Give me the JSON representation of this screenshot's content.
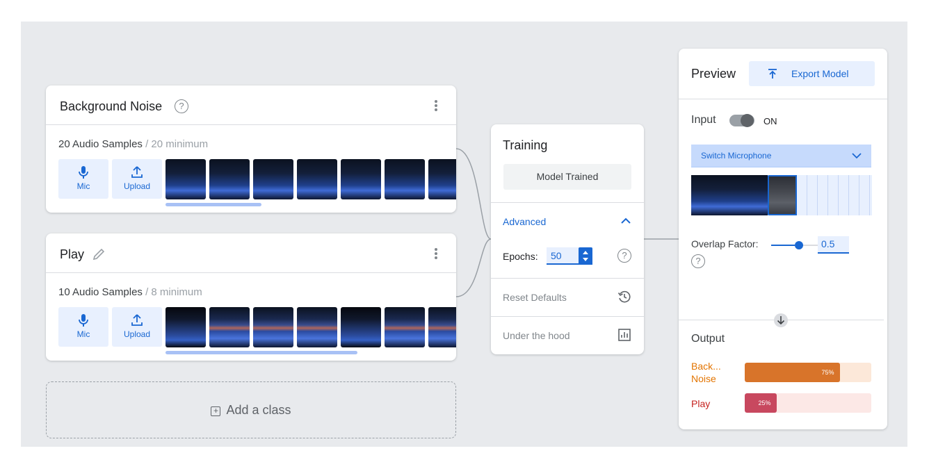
{
  "classes": [
    {
      "name": "Background Noise",
      "samples": "20 Audio Samples",
      "minimum": " / 20 minimum",
      "mic_label": "Mic",
      "upload_label": "Upload",
      "scroll_fraction": 0.33
    },
    {
      "name": "Play",
      "samples": "10 Audio Samples",
      "minimum": " / 8 minimum",
      "mic_label": "Mic",
      "upload_label": "Upload",
      "scroll_fraction": 0.66
    }
  ],
  "add_class": {
    "label": "Add a class",
    "icon": "plus-square-icon"
  },
  "training": {
    "title": "Training",
    "status_button": "Model Trained",
    "advanced_label": "Advanced",
    "epochs_label": "Epochs:",
    "epochs_value": "50",
    "reset_label": "Reset Defaults",
    "hood_label": "Under the hood"
  },
  "preview": {
    "title": "Preview",
    "export_label": "Export Model",
    "input_label": "Input",
    "toggle_text": "ON",
    "toggle_on": true,
    "mic_select": "Switch Microphone",
    "overlap_label": "Overlap Factor:",
    "overlap_value": "0.5",
    "output_title": "Output",
    "outputs": [
      {
        "label": "Back... Noise",
        "percent_label": "75%",
        "percent": 75,
        "color": "#e37400",
        "track": "#fce8d9"
      },
      {
        "label": "Play",
        "percent_label": "25%",
        "percent": 25,
        "color": "#c5221f",
        "track": "#fce8e6"
      }
    ]
  },
  "colors": {
    "accent": "#1967d2",
    "canvas": "#e8eaed"
  }
}
